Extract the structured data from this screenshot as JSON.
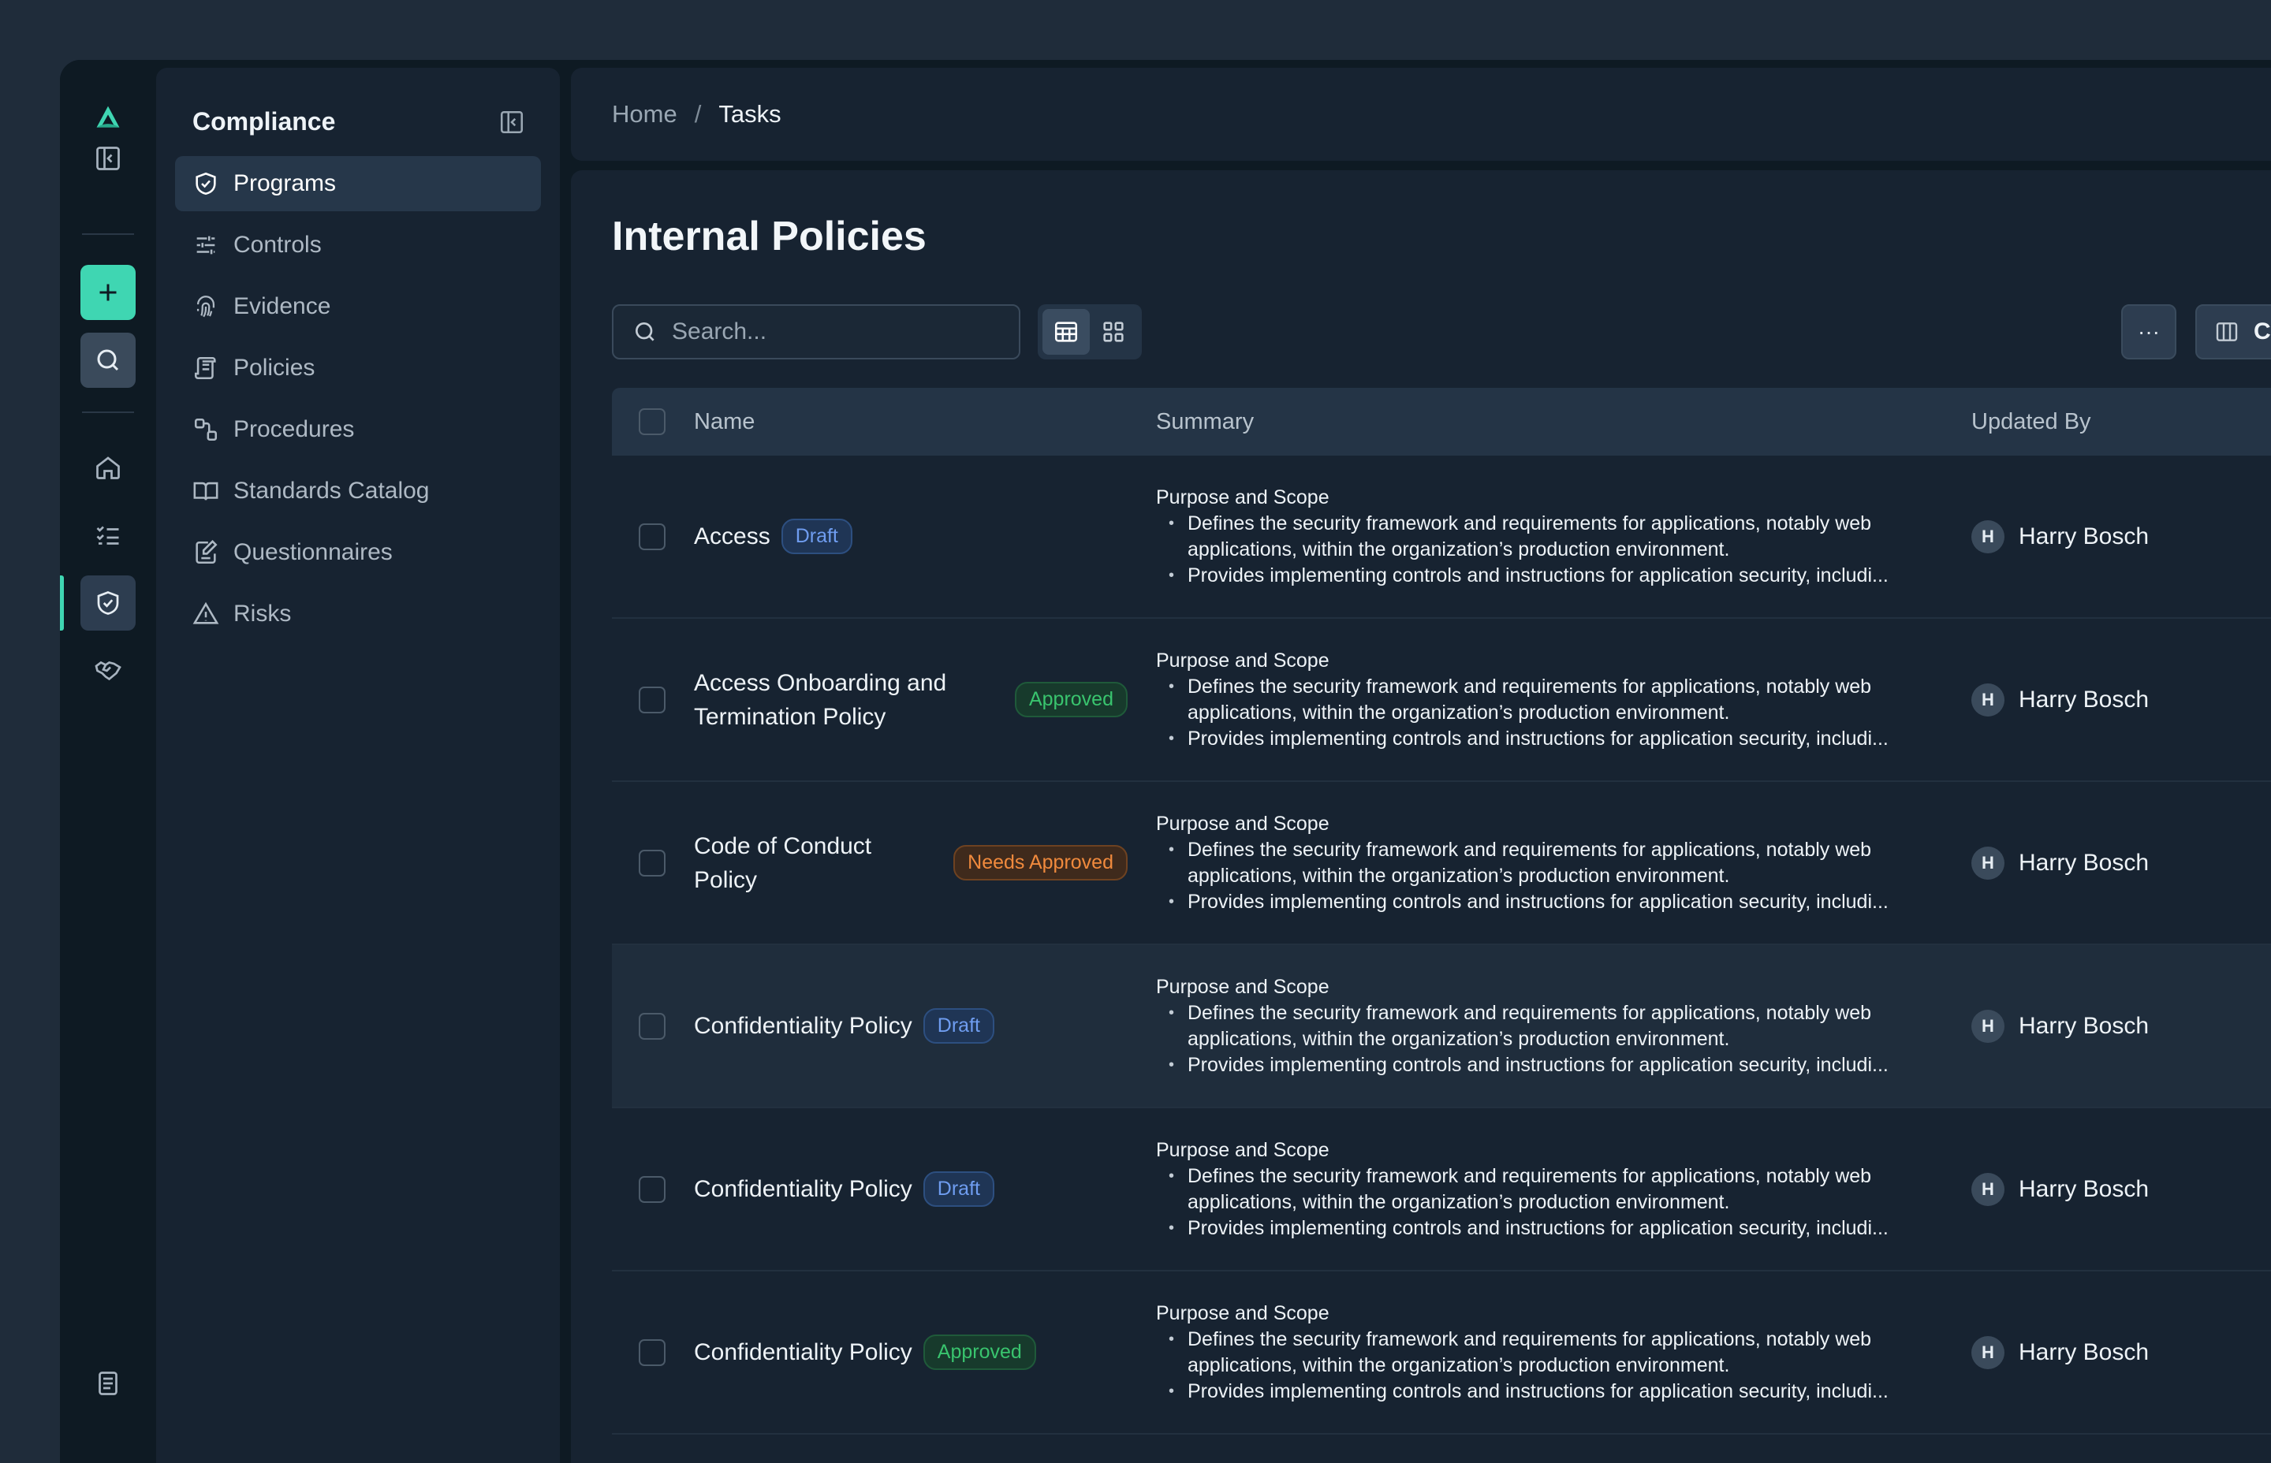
{
  "breadcrumb": {
    "home": "Home",
    "separator": "/",
    "current": "Tasks"
  },
  "sidebar": {
    "title": "Compliance",
    "items": [
      {
        "label": "Programs",
        "icon": "shield-check-icon",
        "active": true
      },
      {
        "label": "Controls",
        "icon": "sliders-icon"
      },
      {
        "label": "Evidence",
        "icon": "fingerprint-icon"
      },
      {
        "label": "Policies",
        "icon": "scroll-icon"
      },
      {
        "label": "Procedures",
        "icon": "workflow-icon"
      },
      {
        "label": "Standards Catalog",
        "icon": "book-open-icon"
      },
      {
        "label": "Questionnaires",
        "icon": "edit-document-icon"
      },
      {
        "label": "Risks",
        "icon": "warning-triangle-icon"
      }
    ]
  },
  "main": {
    "title": "Internal Policies",
    "search_placeholder": "Search...",
    "columns_label": "Columns",
    "more_label": "···",
    "headers": {
      "name": "Name",
      "summary": "Summary",
      "updated_by": "Updated By"
    },
    "rows": [
      {
        "name": "Access",
        "status": "Draft",
        "status_type": "draft",
        "summary_title": "Purpose and Scope",
        "bullet1": "Defines the security framework and requirements for applications, notably web applications, within the organization’s production environment.",
        "bullet2": "Provides implementing controls and instructions for application security, includi...",
        "avatar": "H",
        "updated_by": "Harry Bosch"
      },
      {
        "name": "Access Onboarding and Termination Policy",
        "status": "Approved",
        "status_type": "approved",
        "summary_title": "Purpose and Scope",
        "bullet1": "Defines the security framework and requirements for applications, notably web applications, within the organization’s production environment.",
        "bullet2": "Provides implementing controls and instructions for application security, includi...",
        "avatar": "H",
        "updated_by": "Harry Bosch"
      },
      {
        "name": "Code of Conduct Policy",
        "status": "Needs Approved",
        "status_type": "needs",
        "summary_title": "Purpose and Scope",
        "bullet1": "Defines the security framework and requirements for applications, notably web applications, within the organization’s production environment.",
        "bullet2": "Provides implementing controls and instructions for application security, includi...",
        "avatar": "H",
        "updated_by": "Harry Bosch"
      },
      {
        "name": "Confidentiality Policy",
        "status": "Draft",
        "status_type": "draft",
        "summary_title": "Purpose and Scope",
        "bullet1": "Defines the security framework and requirements for applications, notably web applications, within the organization’s production environment.",
        "bullet2": "Provides implementing controls and instructions for application security, includi...",
        "avatar": "H",
        "updated_by": "Harry Bosch"
      },
      {
        "name": "Confidentiality Policy",
        "status": "Draft",
        "status_type": "draft",
        "summary_title": "Purpose and Scope",
        "bullet1": "Defines the security framework and requirements for applications, notably web applications, within the organization’s production environment.",
        "bullet2": "Provides implementing controls and instructions for application security, includi...",
        "avatar": "H",
        "updated_by": "Harry Bosch"
      },
      {
        "name": "Confidentiality Policy",
        "status": "Approved",
        "status_type": "approved",
        "summary_title": "Purpose and Scope",
        "bullet1": "Defines the security framework and requirements for applications, notably web applications, within the organization’s production environment.",
        "bullet2": "Provides implementing controls and instructions for application security, includi...",
        "avatar": "H",
        "updated_by": "Harry Bosch"
      }
    ]
  },
  "colors": {
    "accent": "#3fd6b2",
    "draft": "#6f9df0",
    "approved": "#39c46e",
    "needs_approval": "#f08a3d"
  }
}
